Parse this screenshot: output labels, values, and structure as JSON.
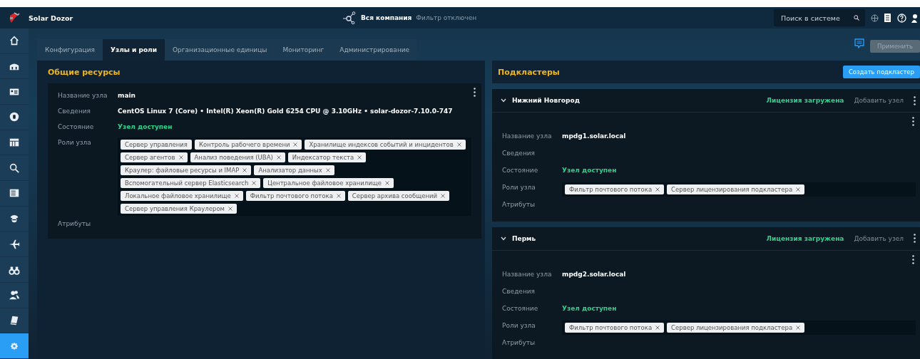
{
  "topbar": {
    "app_name": "Solar Dozor",
    "scope": "Вся компания",
    "filter_status": "Фильтр отключен",
    "search": {
      "placeholder": "Поиск в системе"
    }
  },
  "sidebar": {
    "items": [
      {
        "selected": false
      },
      {
        "selected": false
      },
      {
        "selected": false
      },
      {
        "selected": false
      },
      {
        "selected": false
      },
      {
        "selected": false
      },
      {
        "selected": false
      },
      {
        "selected": false
      },
      {
        "selected": false
      },
      {
        "selected": false
      },
      {
        "selected": false
      },
      {
        "selected": false
      },
      {
        "selected": true
      }
    ]
  },
  "tabs": [
    {
      "label": "Конфигурация",
      "selected": false
    },
    {
      "label": "Узлы и роли",
      "selected": true
    },
    {
      "label": "Организационные единицы",
      "selected": false
    },
    {
      "label": "Мониторинг",
      "selected": false
    },
    {
      "label": "Администрирование",
      "selected": false
    }
  ],
  "apply_button": "Применить",
  "shared_resources": {
    "title": "Общие ресурсы",
    "node": {
      "fields": [
        {
          "label": "Название узла",
          "value": "main",
          "kind": "name"
        },
        {
          "label": "Сведения",
          "value": "CentOS Linux 7 (Core) • Intel(R) Xeon(R) Gold 6254 CPU @ 3.10GHz • solar-dozor-7.10.0-747",
          "kind": "text"
        },
        {
          "label": "Состояние",
          "value": "Узел доступен",
          "kind": "status"
        },
        {
          "label": "Роли узла",
          "kind": "roles",
          "roles": [
            {
              "label": "Сервер управления",
              "removable": false
            },
            {
              "label": "Контроль рабочего времени",
              "removable": true
            },
            {
              "label": "Хранилище индексов событий и инцидентов",
              "removable": true
            },
            {
              "label": "Сервер агентов",
              "removable": true
            },
            {
              "label": "Анализ поведения (UBA)",
              "removable": true
            },
            {
              "label": "Индексатор текста",
              "removable": true
            },
            {
              "label": "Краулер: файловые ресурсы и IMAP",
              "removable": true
            },
            {
              "label": "Анализатор данных",
              "removable": true
            },
            {
              "label": "Вспомогательный сервер Elasticsearch",
              "removable": true
            },
            {
              "label": "Центральное файловое хранилище",
              "removable": true
            },
            {
              "label": "Локальное файловое хранилище",
              "removable": true
            },
            {
              "label": "Фильтр почтового потока",
              "removable": true
            },
            {
              "label": "Сервер архива сообщений",
              "removable": true
            },
            {
              "label": "Сервер управления Краулером",
              "removable": true
            }
          ]
        },
        {
          "label": "Атрибуты",
          "kind": "text"
        }
      ]
    }
  },
  "subclusters": {
    "title": "Подкластеры",
    "create_button": "Создать подкластер",
    "items": [
      {
        "name": "Нижний Новгород",
        "expanded": true,
        "license": "Лицензия загружена",
        "add_node": "Добавить узел",
        "node": {
          "fields": [
            {
              "label": "Название узла",
              "value": "mpdg1.solar.local",
              "kind": "name"
            },
            {
              "label": "Сведения",
              "kind": "text"
            },
            {
              "label": "Состояние",
              "value": "Узел доступен",
              "kind": "status"
            },
            {
              "label": "Роли узла",
              "kind": "roles",
              "roles": [
                {
                  "label": "Фильтр почтового потока",
                  "removable": true
                },
                {
                  "label": "Сервер лицензирования подкластера",
                  "removable": true
                }
              ]
            },
            {
              "label": "Атрибуты",
              "kind": "text"
            }
          ]
        }
      },
      {
        "name": "Пермь",
        "expanded": true,
        "license": "Лицензия загружена",
        "add_node": "Добавить узел",
        "node": {
          "fields": [
            {
              "label": "Название узла",
              "value": "mpdg2.solar.local",
              "kind": "name"
            },
            {
              "label": "Сведения",
              "kind": "text"
            },
            {
              "label": "Состояние",
              "value": "Узел доступен",
              "kind": "status"
            },
            {
              "label": "Роли узла",
              "kind": "roles",
              "roles": [
                {
                  "label": "Фильтр почтового потока",
                  "removable": true
                },
                {
                  "label": "Сервер лицензирования подкластера",
                  "removable": true
                }
              ]
            },
            {
              "label": "Атрибуты",
              "kind": "text"
            }
          ]
        }
      }
    ]
  }
}
